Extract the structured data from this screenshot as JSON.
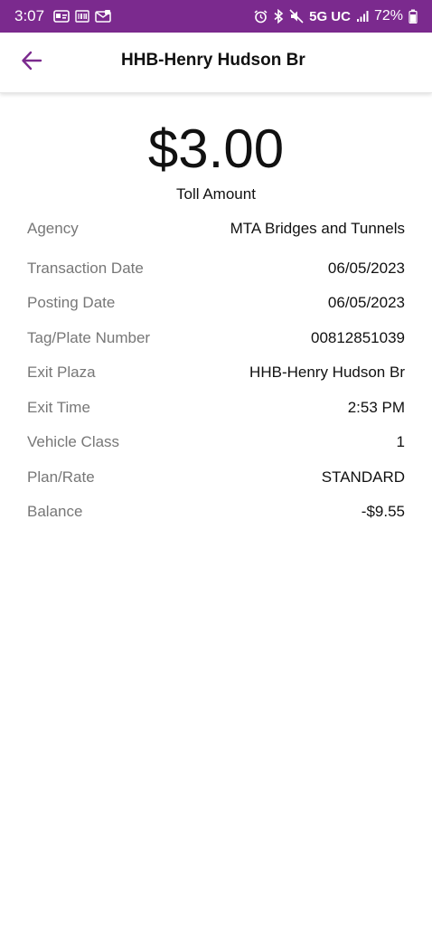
{
  "status_bar": {
    "time": "3:07",
    "network": "5G UC",
    "battery": "72%",
    "background_color": "#7b2a8e",
    "left_icons": [
      "pay-app-icon",
      "barcode-app-icon",
      "mail-app-icon"
    ],
    "right_icons": [
      "alarm-icon",
      "bluetooth-icon",
      "mute-icon",
      "signal-icon",
      "battery-icon"
    ]
  },
  "app_bar": {
    "title": "HHB-Henry Hudson Br",
    "back_icon": "arrow-left-icon",
    "accent_color": "#7b2a8e"
  },
  "summary": {
    "amount": "$3.00",
    "amount_label": "Toll Amount"
  },
  "details": [
    {
      "label": "Agency",
      "value": "MTA Bridges and Tunnels"
    },
    {
      "label": "Transaction Date",
      "value": "06/05/2023"
    },
    {
      "label": "Posting Date",
      "value": "06/05/2023"
    },
    {
      "label": "Tag/Plate Number",
      "value": "00812851039"
    },
    {
      "label": "Exit Plaza",
      "value": "HHB-Henry Hudson Br"
    },
    {
      "label": "Exit Time",
      "value": "2:53 PM"
    },
    {
      "label": "Vehicle Class",
      "value": "1"
    },
    {
      "label": "Plan/Rate",
      "value": "STANDARD"
    },
    {
      "label": "Balance",
      "value": "-$9.55"
    }
  ]
}
